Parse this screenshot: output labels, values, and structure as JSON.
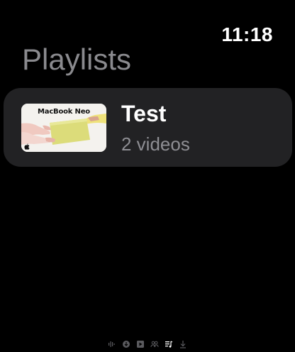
{
  "status_bar": {
    "time": "11:18"
  },
  "page": {
    "title": "Playlists"
  },
  "playlists": [
    {
      "title": "Test",
      "subtitle": "2 videos",
      "thumbnail": {
        "caption": "MacBook Neo",
        "logo_icon": "apple-logo-icon"
      }
    }
  ],
  "page_indicators": [
    {
      "icon": "waveform-icon",
      "active": false
    },
    {
      "icon": "circle-download-icon",
      "active": false
    },
    {
      "icon": "play-square-icon",
      "active": false
    },
    {
      "icon": "people-icon",
      "active": false
    },
    {
      "icon": "music-list-icon",
      "active": true
    },
    {
      "icon": "download-arrow-icon",
      "active": false
    }
  ],
  "colors": {
    "background": "#000000",
    "card": "#222224",
    "title_gray": "#8a8a8e",
    "subtitle_gray": "#8e8e93",
    "indicator_inactive": "#5a5a5e",
    "indicator_active": "#ffffff"
  }
}
